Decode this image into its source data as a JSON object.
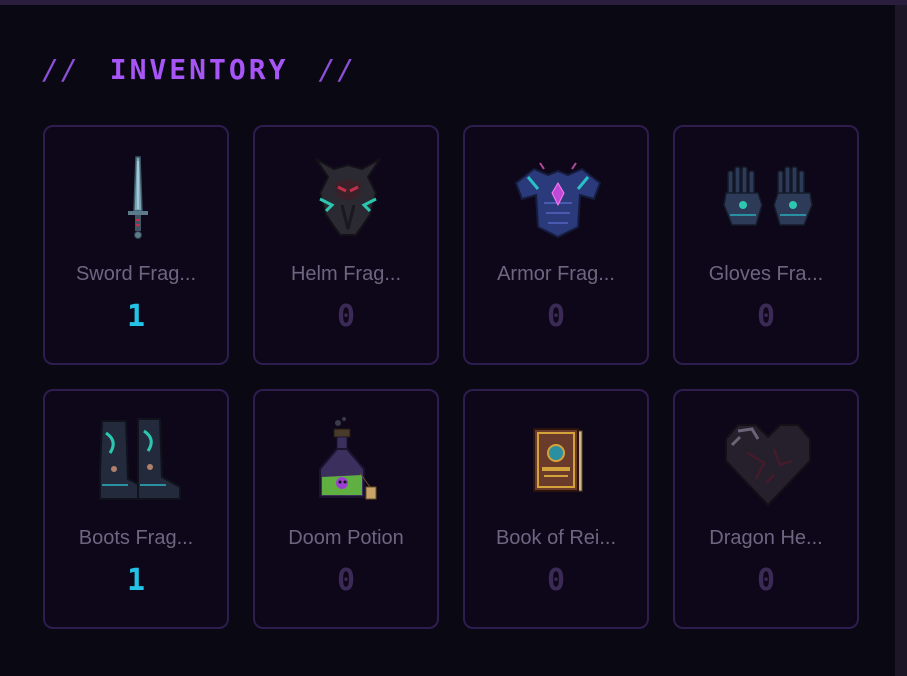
{
  "title": {
    "left_deco": "//",
    "text": "INVENTORY",
    "right_deco": "//"
  },
  "colors": {
    "accent": "#a855f7",
    "count_owned": "#22c3e6",
    "count_zero": "#3a2a55",
    "card_border": "#2e1d4f"
  },
  "items": [
    {
      "name": "Sword Frag...",
      "count": "1",
      "icon": "sword-icon"
    },
    {
      "name": "Helm Frag...",
      "count": "0",
      "icon": "helm-icon"
    },
    {
      "name": "Armor Frag...",
      "count": "0",
      "icon": "armor-icon"
    },
    {
      "name": "Gloves Fra...",
      "count": "0",
      "icon": "gloves-icon"
    },
    {
      "name": "Boots Frag...",
      "count": "1",
      "icon": "boots-icon"
    },
    {
      "name": "Doom Potion",
      "count": "0",
      "icon": "potion-icon"
    },
    {
      "name": "Book of Rei...",
      "count": "0",
      "icon": "book-icon"
    },
    {
      "name": "Dragon He...",
      "count": "0",
      "icon": "heart-icon"
    }
  ]
}
